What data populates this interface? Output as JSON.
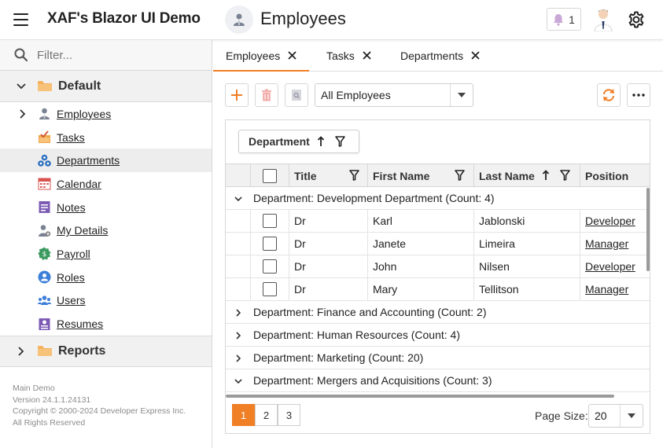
{
  "header": {
    "app_title": "XAF's Blazor UI Demo",
    "view_title": "Employees",
    "notification_count": "1"
  },
  "sidebar": {
    "filter_placeholder": "Filter...",
    "groups": [
      {
        "label": "Default",
        "expanded": true
      },
      {
        "label": "Reports",
        "expanded": false
      }
    ],
    "items": [
      {
        "label": "Employees",
        "icon": "employee-icon",
        "expandable": true
      },
      {
        "label": "Tasks",
        "icon": "tasks-icon"
      },
      {
        "label": "Departments",
        "icon": "departments-icon",
        "selected": true
      },
      {
        "label": "Calendar",
        "icon": "calendar-icon"
      },
      {
        "label": "Notes",
        "icon": "notes-icon"
      },
      {
        "label": "My Details",
        "icon": "my-details-icon"
      },
      {
        "label": "Payroll",
        "icon": "payroll-icon"
      },
      {
        "label": "Roles",
        "icon": "roles-icon"
      },
      {
        "label": "Users",
        "icon": "users-icon"
      },
      {
        "label": "Resumes",
        "icon": "resumes-icon"
      }
    ],
    "footer": [
      "Main Demo",
      "Version 24.1.1.24131",
      "Copyright © 2000-2024 Developer Express Inc.",
      "All Rights Reserved"
    ]
  },
  "tabs": [
    {
      "label": "Employees",
      "active": true
    },
    {
      "label": "Tasks"
    },
    {
      "label": "Departments"
    }
  ],
  "toolbar": {
    "filter_select": "All Employees"
  },
  "grid": {
    "group_panel_label": "Department",
    "columns": [
      "Title",
      "First Name",
      "Last Name",
      "Position"
    ],
    "groups": [
      {
        "label": "Department: Development Department (Count: 4)",
        "expanded": true,
        "rows": [
          {
            "title": "Dr",
            "first": "Karl",
            "last": "Jablonski",
            "position": "Developer"
          },
          {
            "title": "Dr",
            "first": "Janete",
            "last": "Limeira",
            "position": "Manager"
          },
          {
            "title": "Dr",
            "first": "John",
            "last": "Nilsen",
            "position": "Developer"
          },
          {
            "title": "Dr",
            "first": "Mary",
            "last": "Tellitson",
            "position": "Manager"
          }
        ]
      },
      {
        "label": "Department: Finance and Accounting (Count: 2)",
        "expanded": false
      },
      {
        "label": "Department: Human Resources (Count: 4)",
        "expanded": false
      },
      {
        "label": "Department: Marketing (Count: 20)",
        "expanded": false
      },
      {
        "label": "Department: Mergers and Acquisitions (Count: 3)",
        "expanded": true
      }
    ],
    "pager": {
      "pages": [
        "1",
        "2",
        "3"
      ],
      "current_page": "1",
      "page_size_label": "Page Size:",
      "page_size": "20"
    }
  },
  "colors": {
    "accent": "#f07f25",
    "header_bg": "#ffffff",
    "sidebar_group_bg": "#f1f1f1",
    "selected_item_bg": "#ededed"
  }
}
